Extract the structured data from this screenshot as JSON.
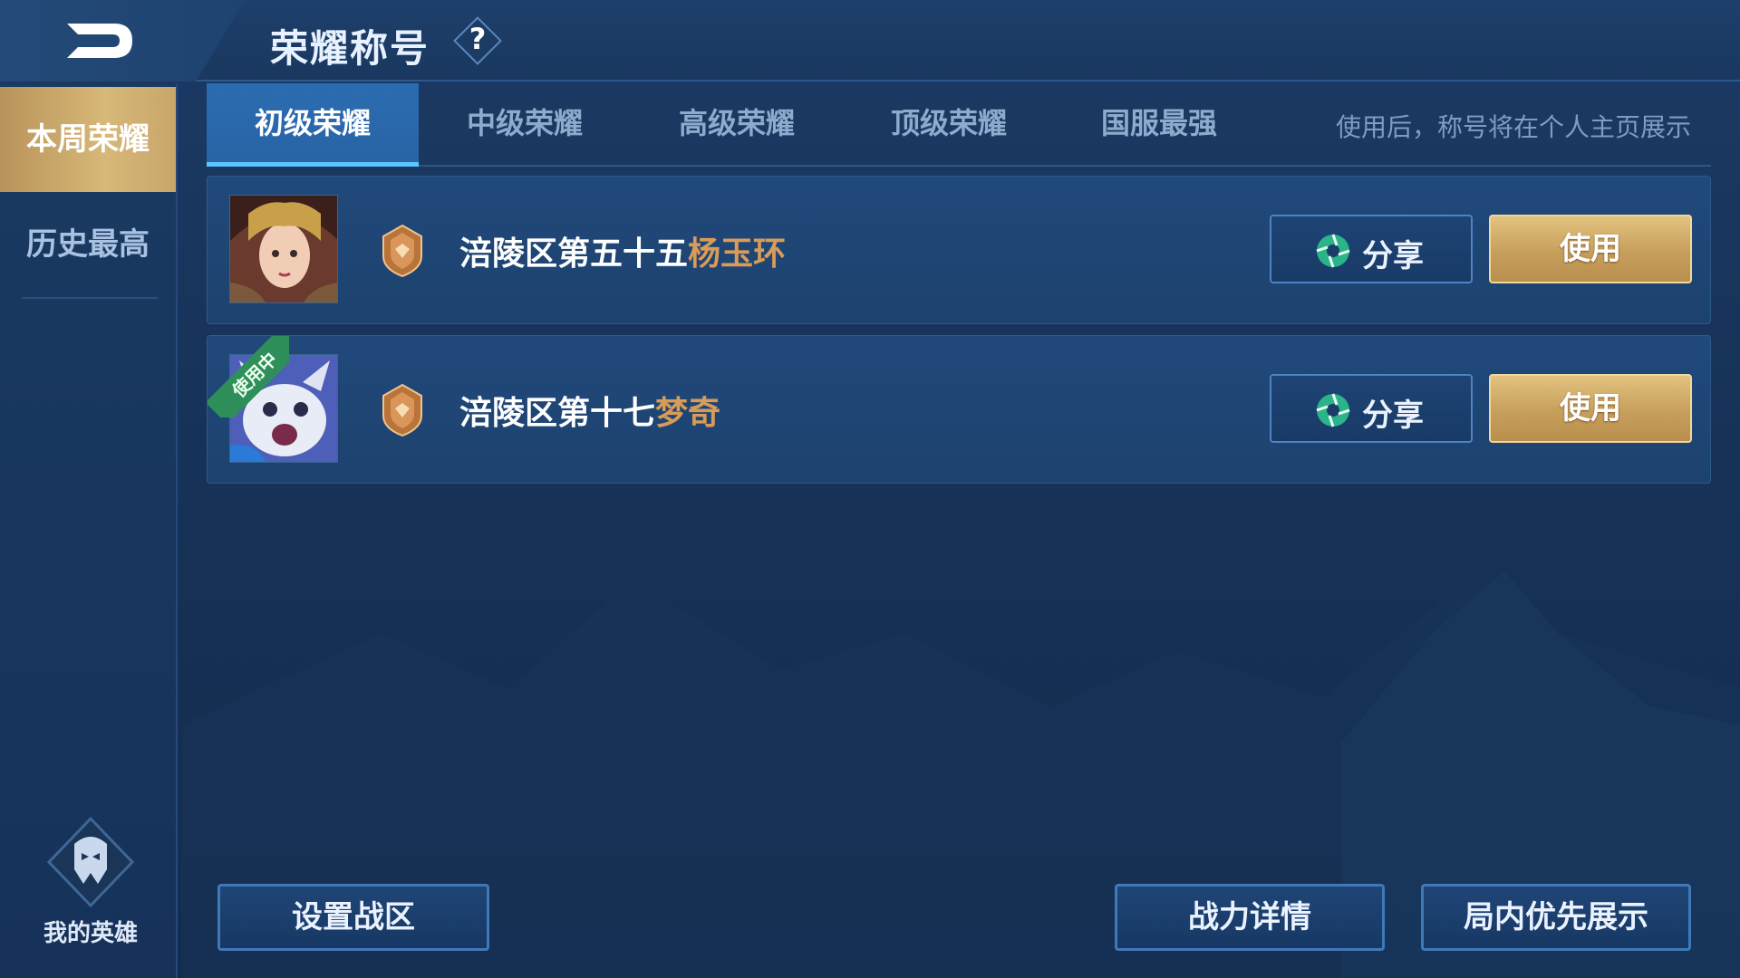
{
  "header": {
    "title": "荣耀称号",
    "help_symbol": "?"
  },
  "sidebar": {
    "items": [
      {
        "label": "本周荣耀",
        "active": true
      },
      {
        "label": "历史最高",
        "active": false
      }
    ],
    "my_hero_label": "我的英雄"
  },
  "tabs": {
    "items": [
      {
        "label": "初级荣耀",
        "active": true
      },
      {
        "label": "中级荣耀",
        "active": false
      },
      {
        "label": "高级荣耀",
        "active": false
      },
      {
        "label": "顶级荣耀",
        "active": false
      },
      {
        "label": "国服最强",
        "active": false
      }
    ],
    "hint": "使用后，称号将在个人主页展示"
  },
  "titles": [
    {
      "prefix": "涪陵区第五十五",
      "hero": "杨玉环",
      "in_use": false,
      "share_label": "分享",
      "use_label": "使用"
    },
    {
      "prefix": "涪陵区第十七",
      "hero": "梦奇",
      "in_use": true,
      "in_use_label": "使用中",
      "share_label": "分享",
      "use_label": "使用"
    }
  ],
  "bottom": {
    "set_region": "设置战区",
    "power_details": "战力详情",
    "priority_display": "局内优先展示"
  },
  "colors": {
    "accent_blue": "#2b6cb0",
    "gold": "#c79f5c",
    "hero_name": "#d99b58",
    "in_use_ribbon": "#2f8f5a"
  }
}
